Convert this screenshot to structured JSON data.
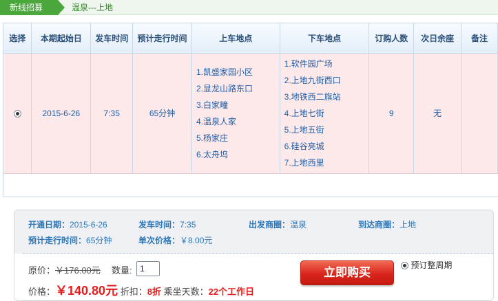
{
  "topbar": {
    "tab_label": "新线招募",
    "route_name": "温泉---上地"
  },
  "table": {
    "headers": [
      "选择",
      "本期起始日",
      "发车时间",
      "预计走行时间",
      "上车地点",
      "下车地点",
      "订购人数",
      "次日余座",
      "备注"
    ],
    "row": {
      "start_date": "2015-6-26",
      "depart_time": "7:35",
      "duration": "65分钟",
      "board_stops": [
        "1.凯盛家园小区",
        "2.显龙山路东口",
        "3.白家疃",
        "4.温泉人家",
        "5.杨家庄",
        "6.太舟坞"
      ],
      "alight_stops": [
        "1.软件园广场",
        "2.上地九街西口",
        "3.地铁西二旗站",
        "4.上地七街",
        "5.上地五街",
        "6.硅谷亮城",
        "7.上地西里"
      ],
      "subscribers": "9",
      "next_day_seats": "无",
      "remarks": ""
    }
  },
  "detail": {
    "open_date_label": "开通日期：",
    "open_date": "2015-6-26",
    "depart_time_label": "发车时间：",
    "depart_time": "7:35",
    "origin_label": "出发商圈：",
    "origin": "温泉",
    "dest_label": "到达商圈：",
    "dest": "上地",
    "duration_label": "预计走行时间：",
    "duration": "65分钟",
    "single_price_label": "单次价格：",
    "single_price": "￥8.00元"
  },
  "purchase": {
    "original_label": "原价：",
    "original_price": "￥176.00元",
    "qty_label": "数量:",
    "qty_value": "1",
    "price_label": "价格：",
    "price": "￥140.80元",
    "discount_label": "折扣：",
    "discount": "8折",
    "days_label": "乘坐天数：",
    "days": "22个工作日",
    "buy_button": "立即购买",
    "option_label": "预订整周期"
  }
}
